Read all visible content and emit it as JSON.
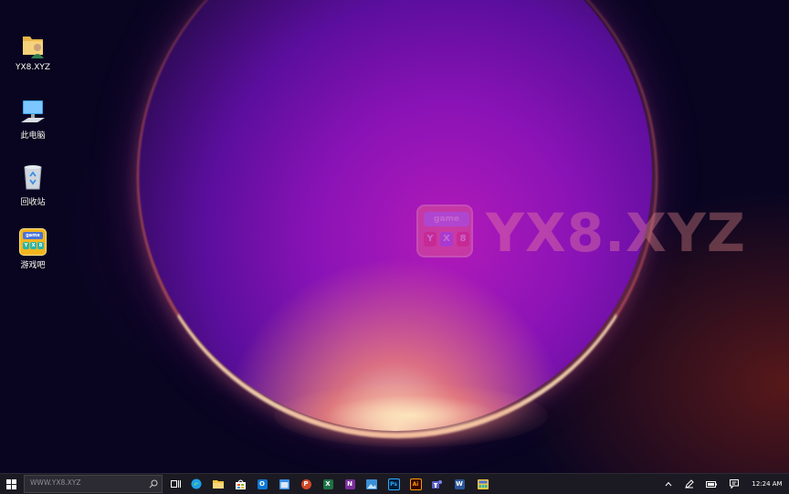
{
  "desktop": {
    "watermark": {
      "logo_top": "game",
      "logo_chips": [
        "Y",
        "X",
        "8"
      ],
      "text": "YX8.XYZ"
    },
    "icons": [
      {
        "label": "YX8.XYZ",
        "icon": "user-folder-icon"
      },
      {
        "label": "此电脑",
        "icon": "computer-icon"
      },
      {
        "label": "回收站",
        "icon": "recycle-bin-icon"
      },
      {
        "label": "游戏吧",
        "icon": "game-app-icon"
      }
    ],
    "game_icon_top": "game",
    "game_icon_chips": [
      "Y",
      "X",
      "8"
    ]
  },
  "taskbar": {
    "search_placeholder": "WWW.YX8.XYZ",
    "apps": [
      {
        "icon": "task-view-icon"
      },
      {
        "icon": "edge-icon",
        "color": "#1fa0e8"
      },
      {
        "icon": "file-explorer-icon",
        "color": "#f4c542"
      },
      {
        "icon": "store-icon",
        "color": "#ffffff"
      },
      {
        "icon": "outlook-icon",
        "color": "#0f78d4",
        "letter": "O"
      },
      {
        "icon": "calendar-icon",
        "color": "#3a8ee6"
      },
      {
        "icon": "powerpoint-icon",
        "color": "#d24726",
        "letter": "P"
      },
      {
        "icon": "excel-icon",
        "color": "#1e7145",
        "letter": "X"
      },
      {
        "icon": "onenote-icon",
        "color": "#7c2e9e",
        "letter": "N"
      },
      {
        "icon": "photos-icon",
        "color": "#3b8fd6"
      },
      {
        "icon": "photoshop-icon",
        "color": "#001e36",
        "letter": "Ps"
      },
      {
        "icon": "illustrator-icon",
        "color": "#330000",
        "letter": "Ai"
      },
      {
        "icon": "teams-icon",
        "color": "#5b5fc7"
      },
      {
        "icon": "word-icon",
        "color": "#2b579a",
        "letter": "W"
      },
      {
        "icon": "game-bar-icon",
        "color": "#f4c542"
      }
    ],
    "clock": "12:24 AM"
  }
}
